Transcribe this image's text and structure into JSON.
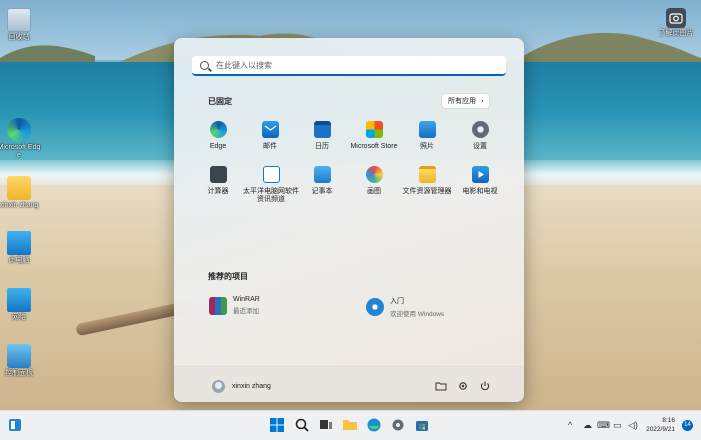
{
  "desktop": {
    "icons": [
      {
        "label": "回收站"
      },
      {
        "label": "Microsoft Edge"
      },
      {
        "label": "xinxin zhang"
      },
      {
        "label": "此电脑"
      },
      {
        "label": "网络"
      },
      {
        "label": "控制面板"
      }
    ],
    "camera_label": "了解此图片"
  },
  "start_menu": {
    "search_placeholder": "在此键入以搜索",
    "pinned_title": "已固定",
    "all_apps_label": "所有应用",
    "pinned_apps": [
      {
        "label": "Edge",
        "icon": "edge-icon"
      },
      {
        "label": "邮件",
        "icon": "mail-icon"
      },
      {
        "label": "日历",
        "icon": "calendar-icon"
      },
      {
        "label": "Microsoft Store",
        "icon": "store-icon"
      },
      {
        "label": "照片",
        "icon": "photos-icon"
      },
      {
        "label": "设置",
        "icon": "settings-icon"
      },
      {
        "label": "计算器",
        "icon": "calculator-icon"
      },
      {
        "label": "太平洋电脑网软件资讯频道",
        "icon": "pconline-icon"
      },
      {
        "label": "记事本",
        "icon": "notepad-icon"
      },
      {
        "label": "画图",
        "icon": "paint-icon"
      },
      {
        "label": "文件资源管理器",
        "icon": "file-explorer-icon"
      },
      {
        "label": "电影和电视",
        "icon": "movies-tv-icon"
      }
    ],
    "recommended_title": "推荐的项目",
    "recommended": [
      {
        "title": "WinRAR",
        "subtitle": "最近添加",
        "icon": "winrar-icon"
      },
      {
        "title": "入门",
        "subtitle": "欢迎使用 Windows",
        "icon": "get-started-icon"
      }
    ],
    "user_name": "xinxin zhang"
  },
  "taskbar": {
    "time": "8:16",
    "date": "2022/9/21",
    "notification_count": "14",
    "colors": {
      "accent": "#0067c0"
    }
  }
}
